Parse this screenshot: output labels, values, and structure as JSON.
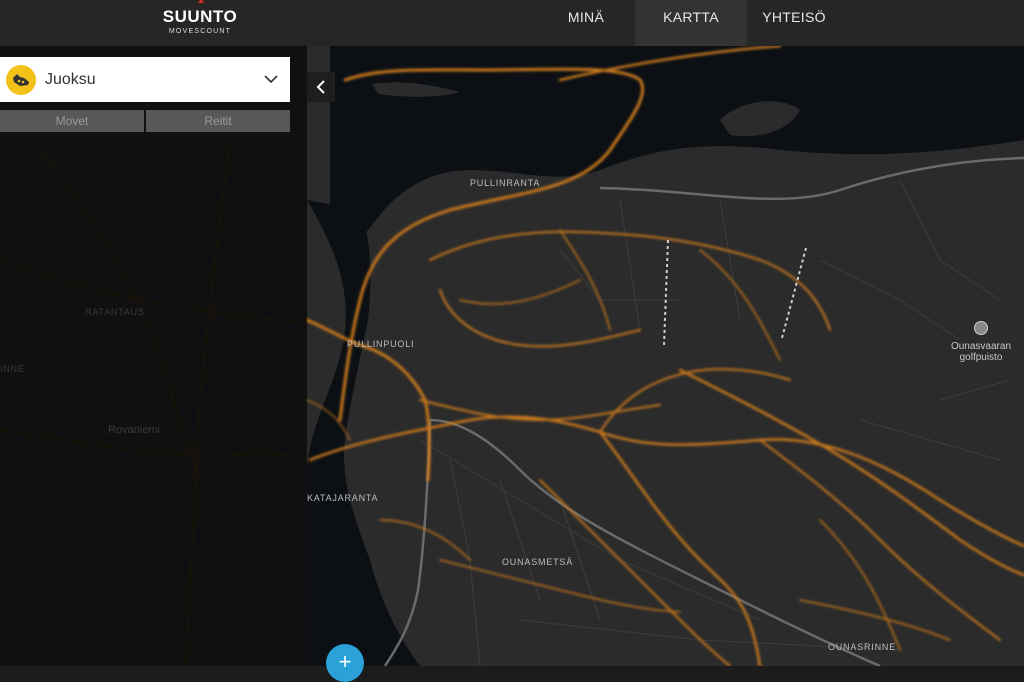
{
  "header": {
    "brand": "SUUNTO",
    "brand_sub": "MOVESCOUNT",
    "nav": [
      {
        "label": "MINÄ",
        "active": false
      },
      {
        "label": "KARTTA",
        "active": true
      },
      {
        "label": "YHTEISÖ",
        "active": false
      }
    ]
  },
  "sidebar": {
    "sport": "Juoksu",
    "tabs": [
      "Movet",
      "Reitit"
    ]
  },
  "map": {
    "labels": [
      {
        "text": "PULLINRANTA"
      },
      {
        "text": "PULLINPUOLI"
      },
      {
        "text": "KATAJARANTA"
      },
      {
        "text": "OUNASMETSÄ"
      },
      {
        "text": "OUNASRINNE"
      },
      {
        "text": "RATANTAUS"
      },
      {
        "text": "Rovaniemi"
      },
      {
        "text": "INNE"
      }
    ],
    "poi": "Ounasvaaran golfpuisto",
    "fab": "+"
  },
  "colors": {
    "heat": "#c9781f",
    "water": "#0c1014",
    "fab": "#2aa2d8",
    "sport_icon": "#f2c21a"
  }
}
